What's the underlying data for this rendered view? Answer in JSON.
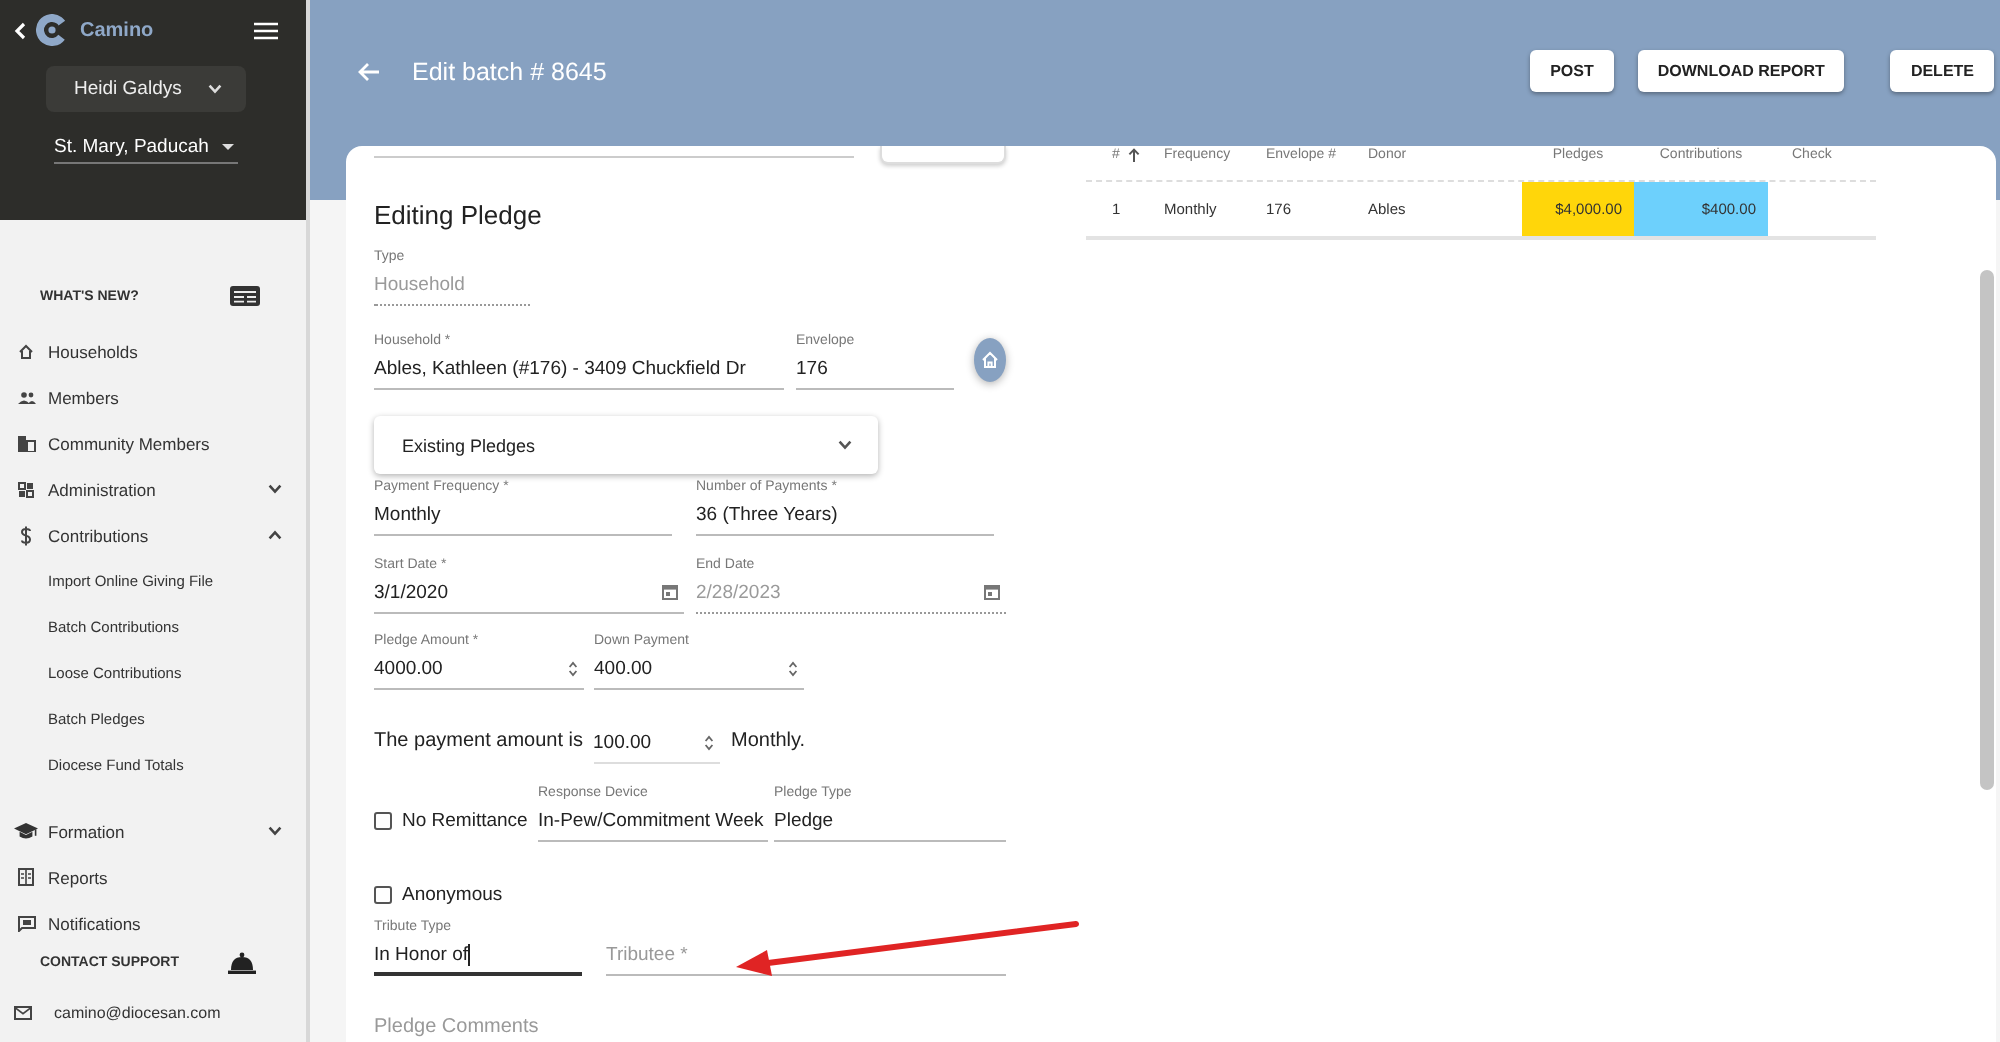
{
  "sidebar": {
    "brand": "Camino",
    "user": "Heidi Galdys",
    "parish": "St. Mary, Paducah",
    "whats_new": "WHAT'S NEW?",
    "items": [
      {
        "label": "Households",
        "kind": "link",
        "expanded": false
      },
      {
        "label": "Members",
        "kind": "link",
        "expanded": false
      },
      {
        "label": "Community Members",
        "kind": "link",
        "expanded": false
      },
      {
        "label": "Administration",
        "kind": "group",
        "expanded": false
      },
      {
        "label": "Contributions",
        "kind": "group",
        "expanded": true,
        "children": [
          {
            "label": "Import Online Giving File"
          },
          {
            "label": "Batch Contributions"
          },
          {
            "label": "Loose Contributions"
          },
          {
            "label": "Batch Pledges"
          },
          {
            "label": "Diocese Fund Totals"
          }
        ]
      },
      {
        "label": "Formation",
        "kind": "group",
        "expanded": false
      },
      {
        "label": "Reports",
        "kind": "link",
        "expanded": false
      },
      {
        "label": "Notifications",
        "kind": "link",
        "expanded": false
      }
    ],
    "contact_support": "CONTACT SUPPORT",
    "email": "camino@diocesan.com"
  },
  "header": {
    "title": "Edit batch # 8645",
    "buttons": [
      "POST",
      "DOWNLOAD REPORT",
      "DELETE"
    ]
  },
  "form": {
    "title": "Editing Pledge",
    "type": {
      "label": "Type",
      "value": "Household",
      "disabled": true
    },
    "household": {
      "label": "Household *",
      "value": "Ables, Kathleen (#176) - 3409 Chuckfield Dr",
      "disabled": false
    },
    "envelope": {
      "label": "Envelope",
      "value": "176",
      "disabled": false
    },
    "existing_pledges": {
      "label": "Existing Pledges",
      "expanded": false
    },
    "payment_frequency": {
      "label": "Payment Frequency *",
      "value": "Monthly",
      "disabled": false
    },
    "number_of_payments": {
      "label": "Number of Payments *",
      "value": "36 (Three Years)",
      "disabled": false
    },
    "start_date": {
      "kind": "date",
      "label": "Start Date *",
      "value": "3/1/2020",
      "disabled": false
    },
    "end_date": {
      "kind": "date",
      "label": "End Date",
      "value": "2/28/2023",
      "disabled": true
    },
    "pledge_amount": {
      "kind": "number",
      "label": "Pledge Amount *",
      "value": "4000.00",
      "disabled": false
    },
    "down_payment": {
      "kind": "number",
      "label": "Down Payment",
      "value": "400.00",
      "disabled": false
    },
    "payment_sentence": {
      "before": "The payment amount is",
      "kind": "number",
      "value": "100.00",
      "after": "Monthly."
    },
    "no_remittance": {
      "label": "No Remittance",
      "checked": false
    },
    "response_device": {
      "label": "Response Device",
      "value": "In-Pew/Commitment Week",
      "disabled": false
    },
    "pledge_type": {
      "label": "Pledge Type",
      "value": "Pledge",
      "disabled": false
    },
    "anonymous": {
      "label": "Anonymous",
      "checked": false
    },
    "tribute_type": {
      "label": "Tribute Type",
      "value": "In Honor of",
      "focused": true,
      "disabled": false
    },
    "tributee": {
      "placeholder": "Tributee *",
      "focused": false,
      "disabled": false
    },
    "pledge_comments": {
      "placeholder": "Pledge Comments"
    }
  },
  "table": {
    "columns": [
      {
        "label": "#",
        "sorted": true
      },
      {
        "label": "Frequency",
        "sorted": false
      },
      {
        "label": "Envelope #",
        "sorted": false
      },
      {
        "label": "Donor",
        "sorted": false
      },
      {
        "label": "Pledges",
        "sorted": false
      },
      {
        "label": "Contributions",
        "sorted": false
      },
      {
        "label": "Check",
        "sorted": false
      }
    ],
    "rows": [
      {
        "cells": [
          {
            "text": "1"
          },
          {
            "text": "Monthly"
          },
          {
            "text": "176"
          },
          {
            "text": "Ables"
          },
          {
            "text": "$4,000.00",
            "color": "#ffd60a"
          },
          {
            "text": "$400.00",
            "color": "#6dd0fc"
          }
        ]
      }
    ]
  }
}
